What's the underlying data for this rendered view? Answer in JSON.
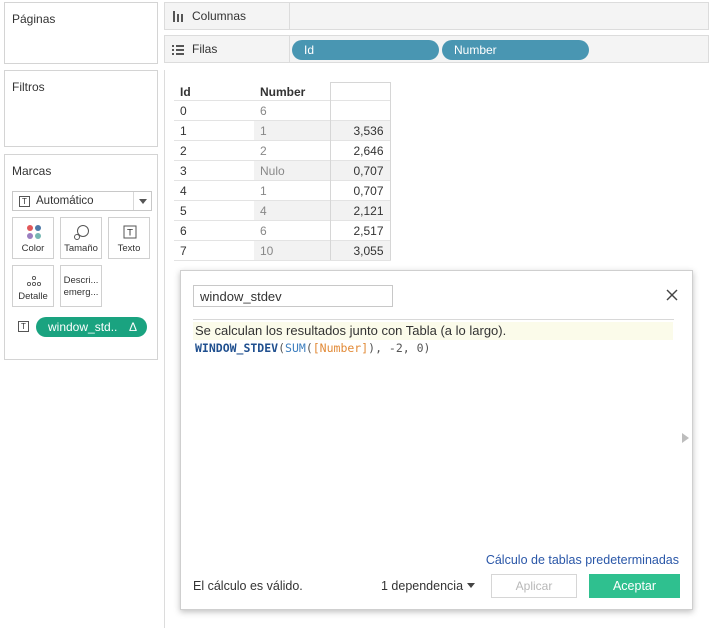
{
  "left_panels": {
    "pages_title": "Páginas",
    "filters_title": "Filtros",
    "marks_title": "Marcas",
    "mark_type": "Automático",
    "mark_buttons": {
      "color": "Color",
      "size": "Tamaño",
      "text": "Texto",
      "detail": "Detalle",
      "tooltip_line1": "Descri...",
      "tooltip_line2": "emerg..."
    },
    "mark_pill": "window_std..",
    "mark_pill_delta": "Δ"
  },
  "shelves": {
    "columns_label": "Columnas",
    "rows_label": "Filas",
    "rows_pills": [
      "Id",
      "Number"
    ]
  },
  "table": {
    "headers": {
      "id": "Id",
      "number": "Number"
    },
    "rows": [
      {
        "id": "0",
        "number": "6",
        "value": ""
      },
      {
        "id": "1",
        "number": "1",
        "value": "3,536"
      },
      {
        "id": "2",
        "number": "2",
        "value": "2,646"
      },
      {
        "id": "3",
        "number": "Nulo",
        "value": "0,707"
      },
      {
        "id": "4",
        "number": "1",
        "value": "0,707"
      },
      {
        "id": "5",
        "number": "4",
        "value": "2,121"
      },
      {
        "id": "6",
        "number": "6",
        "value": "2,517"
      },
      {
        "id": "7",
        "number": "10",
        "value": "3,055"
      }
    ]
  },
  "calc_dialog": {
    "name_value": "window_stdev",
    "hint": "Se calculan los resultados junto con Tabla (a lo largo).",
    "formula": {
      "func": "WINDOW_STDEV",
      "open": "(",
      "agg": "SUM",
      "agg_open": "(",
      "field": "[Number]",
      "rest": "), -2, 0)"
    },
    "default_link": "Cálculo de tablas predeterminadas",
    "status": "El cálculo es válido.",
    "dependency": "1 dependencia",
    "apply_label": "Aplicar",
    "accept_label": "Aceptar"
  },
  "colors": {
    "pill_blue": "#4996b2",
    "pill_green": "#1aa380",
    "accept_green": "#2fc08f",
    "link_blue": "#2a57a8"
  }
}
